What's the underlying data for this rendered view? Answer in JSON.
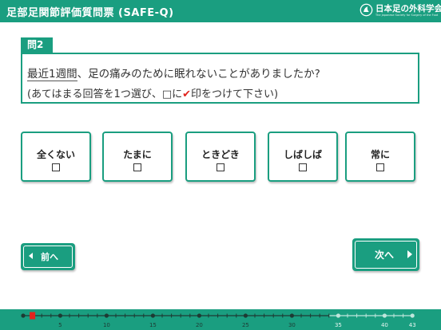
{
  "header": {
    "title": "足部足関節評価質問票 (SAFE-Q)",
    "logo_text": "日本足の外科学会",
    "logo_subtext": "The Japanese Society for Surgery of the Foot"
  },
  "question": {
    "number_label": "問2",
    "text_underlined": "最近1週間",
    "text_rest": "、足の痛みのために眠れないことがありましたか?",
    "instruction_before": "(あてはまる回答を1つ選び、□に",
    "instruction_check": "✔",
    "instruction_after": "印をつけて下さい)"
  },
  "options": [
    {
      "label": "全くない",
      "checked": false
    },
    {
      "label": "たまに",
      "checked": false
    },
    {
      "label": "ときどき",
      "checked": false
    },
    {
      "label": "しばしば",
      "checked": false
    },
    {
      "label": "常に",
      "checked": false
    }
  ],
  "nav": {
    "prev_label": "前へ",
    "next_label": "次へ"
  },
  "progress": {
    "current": 2,
    "total": 43,
    "answered_until": 34,
    "tick_labels": [
      "5",
      "10",
      "15",
      "20",
      "25",
      "30",
      "35",
      "40",
      "43"
    ]
  },
  "colors": {
    "primary": "#1a9e80",
    "checkmark": "#e1231d",
    "current_marker": "#e1231d"
  }
}
